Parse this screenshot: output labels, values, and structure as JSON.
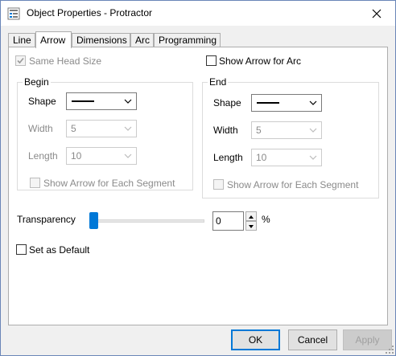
{
  "window": {
    "title": "Object Properties - Protractor",
    "icon": "properties-window-icon"
  },
  "tabs": [
    {
      "label": "Line",
      "active": false
    },
    {
      "label": "Arrow",
      "active": true
    },
    {
      "label": "Dimensions",
      "active": false
    },
    {
      "label": "Arc",
      "active": false
    },
    {
      "label": "Programming",
      "active": false
    }
  ],
  "arrow": {
    "same_head_size": {
      "label": "Same Head Size",
      "checked": true,
      "enabled": false
    },
    "show_arrow_for_arc": {
      "label": "Show Arrow for Arc",
      "checked": false
    },
    "begin": {
      "title": "Begin",
      "shape_label": "Shape",
      "width_label": "Width",
      "width_value": "5",
      "length_label": "Length",
      "length_value": "10",
      "each_segment": {
        "label": "Show Arrow for Each Segment",
        "checked": false,
        "enabled": false
      }
    },
    "end": {
      "title": "End",
      "shape_label": "Shape",
      "width_label": "Width",
      "width_value": "5",
      "length_label": "Length",
      "length_value": "10",
      "each_segment": {
        "label": "Show Arrow for Each Segment",
        "checked": false,
        "enabled": false
      }
    },
    "transparency": {
      "label": "Transparency",
      "value": "0",
      "unit": "%",
      "level": 0
    },
    "set_default": {
      "label": "Set as Default",
      "checked": false
    }
  },
  "buttons": {
    "ok": "OK",
    "cancel": "Cancel",
    "apply": "Apply"
  },
  "colors": {
    "accent": "#0078d7",
    "disabled_text": "#8a8a8a",
    "window_border": "#6a86b8"
  }
}
